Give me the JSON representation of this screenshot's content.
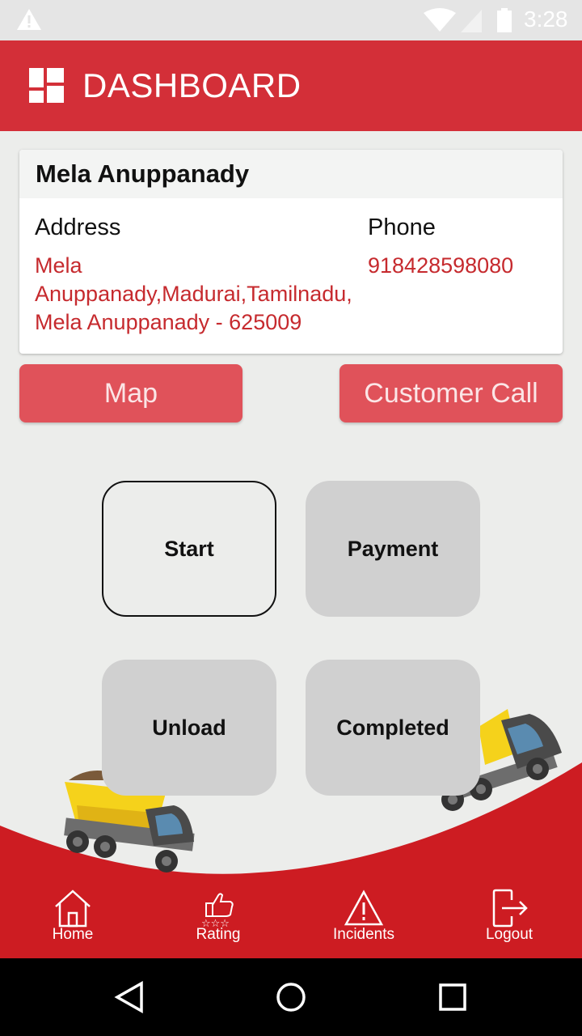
{
  "status_bar": {
    "time": "3:28"
  },
  "header": {
    "title": "DASHBOARD"
  },
  "customer": {
    "name": "Mela Anuppanady",
    "address_label": "Address",
    "phone_label": "Phone",
    "address_line1": "Mela",
    "address_line2": "Anuppanady,Madurai,Tamilnadu,",
    "address_line3": "Mela Anuppanady - 625009",
    "phone": "918428598080"
  },
  "actions": {
    "map_label": "Map",
    "call_label": "Customer Call"
  },
  "tiles": {
    "start": "Start",
    "payment": "Payment",
    "unload": "Unload",
    "completed": "Completed"
  },
  "bottom_nav": {
    "home": "Home",
    "rating": "Rating",
    "incidents": "Incidents",
    "logout": "Logout"
  },
  "colors": {
    "brand_red": "#d32f38",
    "button_red": "#e0525a",
    "text_red": "#c62a2e",
    "tile_gray": "#d0d0d0"
  },
  "icons": [
    "warning-icon",
    "wifi-icon",
    "signal-icon",
    "battery-icon",
    "dashboard-icon",
    "home-icon",
    "rating-icon",
    "incidents-icon",
    "logout-icon",
    "back-icon",
    "home-circle-icon",
    "recents-icon"
  ]
}
